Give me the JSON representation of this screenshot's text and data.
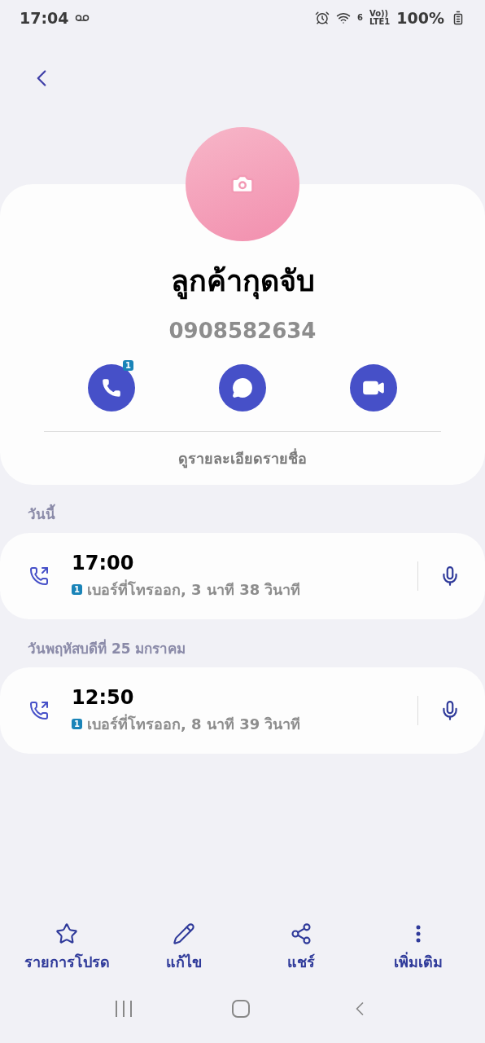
{
  "status_bar": {
    "time": "17:04",
    "wifi_label": "6",
    "volte": "Vo))",
    "network": "LTE1",
    "battery": "100%"
  },
  "contact": {
    "name": "ลูกค้ากุดจับ",
    "phone": "0908582634",
    "call_badge": "1",
    "details_link": "ดูรายละเอียดรายชื่อ"
  },
  "history": [
    {
      "date": "วันนี้",
      "calls": [
        {
          "time": "17:00",
          "sim": "1",
          "detail": "เบอร์ที่โทรออก, 3 นาที 38 วินาที"
        }
      ]
    },
    {
      "date": "วันพฤหัสบดีที่ 25 มกราคม",
      "calls": [
        {
          "time": "12:50",
          "sim": "1",
          "detail": "เบอร์ที่โทรออก, 8 นาที 39 วินาที"
        }
      ]
    }
  ],
  "bottom_actions": [
    {
      "kind": "favorite",
      "label": "รายการโปรด"
    },
    {
      "kind": "edit",
      "label": "แก้ไข"
    },
    {
      "kind": "share",
      "label": "แชร์"
    },
    {
      "kind": "more",
      "label": "เพิ่มเติม"
    }
  ]
}
